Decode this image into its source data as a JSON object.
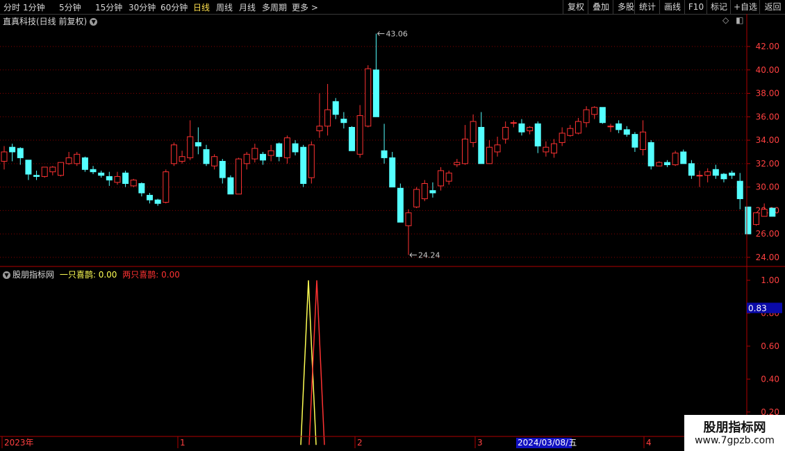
{
  "toolbar": {
    "left": [
      {
        "label": "分时",
        "x": 5
      },
      {
        "label": "1分钟",
        "x": 33
      },
      {
        "label": "5分钟",
        "x": 85
      },
      {
        "label": "15分钟",
        "x": 137
      },
      {
        "label": "30分钟",
        "x": 185
      },
      {
        "label": "60分钟",
        "x": 231
      },
      {
        "label": "日线",
        "x": 278,
        "active": true
      },
      {
        "label": "周线",
        "x": 311
      },
      {
        "label": "月线",
        "x": 344
      },
      {
        "label": "多周期",
        "x": 377
      },
      {
        "label": "更多 >",
        "x": 420
      }
    ],
    "right": [
      {
        "label": "复权",
        "x": 810,
        "w": 36
      },
      {
        "label": "叠加",
        "x": 846,
        "w": 36
      },
      {
        "label": "多股",
        "x": 882,
        "w": 36
      },
      {
        "label": "统计",
        "x": 913,
        "w": 36
      },
      {
        "label": "画线",
        "x": 949,
        "w": 36
      },
      {
        "label": "F10",
        "x": 985,
        "w": 32
      },
      {
        "label": "标记",
        "x": 1017,
        "w": 34
      },
      {
        "label": "+自选",
        "x": 1051,
        "w": 42
      },
      {
        "label": "返回",
        "x": 1093,
        "w": 37
      }
    ]
  },
  "main_title": "直真科技(日线 前复权)",
  "indicator": {
    "name": "股朋指标网",
    "s1_label": "一只喜鹊:",
    "s1_value": "0.00",
    "s2_label": "两只喜鹊:",
    "s2_value": "0.00"
  },
  "price_marker": "0.83",
  "dates": [
    {
      "label": "2023年",
      "x": 6
    },
    {
      "label": "1",
      "x": 259
    },
    {
      "label": "2",
      "x": 514
    },
    {
      "label": "3",
      "x": 687
    },
    {
      "label": "4",
      "x": 930
    }
  ],
  "cursor_date": "2024/03/08/五",
  "watermark": {
    "line1": "股朋指标网",
    "line2": "www.7gpzb.com"
  },
  "colors": {
    "up": "#ff3232",
    "down": "#54ffff",
    "s1": "#ffff54",
    "s2": "#ff3232",
    "grid": "#8b0000",
    "axis": "#b00000"
  },
  "chart_data": [
    {
      "type": "candlestick",
      "title": "直真科技(日线 前复权)",
      "ylim": [
        23.4,
        43.6
      ],
      "yticks": [
        24,
        26,
        28,
        30,
        32,
        34,
        36,
        38,
        40,
        42
      ],
      "high_label": "43.06",
      "low_label": "24.24",
      "candles": [
        [
          32.2,
          33.0,
          31.5,
          33.5
        ],
        [
          33.4,
          33.0,
          32.2,
          33.7
        ],
        [
          33.3,
          32.5,
          31.9,
          33.4
        ],
        [
          32.3,
          31.1,
          30.6,
          32.3
        ],
        [
          31.0,
          30.9,
          30.6,
          31.4
        ],
        [
          30.9,
          31.7,
          30.8,
          31.7
        ],
        [
          31.3,
          31.7,
          31.0,
          31.8
        ],
        [
          31.0,
          32.1,
          30.9,
          32.1
        ],
        [
          32.0,
          32.5,
          31.9,
          33.0
        ],
        [
          32.0,
          32.8,
          31.8,
          33.0
        ],
        [
          32.5,
          31.5,
          31.3,
          32.6
        ],
        [
          31.5,
          31.3,
          31.1,
          31.8
        ],
        [
          31.2,
          31.0,
          30.8,
          31.4
        ],
        [
          30.9,
          30.6,
          30.1,
          31.3
        ],
        [
          30.4,
          30.9,
          30.2,
          31.3
        ],
        [
          31.2,
          30.3,
          30.0,
          31.4
        ],
        [
          30.1,
          30.6,
          30.0,
          30.7
        ],
        [
          30.3,
          29.5,
          29.2,
          30.4
        ],
        [
          29.3,
          28.9,
          28.6,
          29.5
        ],
        [
          28.9,
          28.6,
          28.4,
          29.0
        ],
        [
          28.7,
          31.3,
          28.6,
          31.5
        ],
        [
          32.0,
          33.6,
          31.8,
          33.8
        ],
        [
          32.2,
          32.6,
          32.0,
          33.1
        ],
        [
          32.5,
          34.3,
          32.3,
          35.7
        ],
        [
          33.8,
          33.5,
          32.8,
          35.1
        ],
        [
          33.2,
          32.0,
          31.8,
          33.6
        ],
        [
          31.8,
          32.6,
          31.5,
          32.8
        ],
        [
          32.2,
          30.8,
          30.3,
          32.4
        ],
        [
          30.8,
          29.4,
          29.4,
          31.0
        ],
        [
          29.4,
          32.4,
          29.4,
          32.5
        ],
        [
          32.0,
          32.8,
          31.5,
          33.0
        ],
        [
          32.4,
          33.3,
          32.1,
          33.7
        ],
        [
          32.8,
          32.3,
          31.9,
          33.0
        ],
        [
          32.7,
          33.1,
          32.2,
          33.6
        ],
        [
          33.7,
          32.6,
          32.2,
          33.8
        ],
        [
          32.5,
          34.2,
          32.0,
          34.4
        ],
        [
          33.7,
          33.0,
          32.7,
          34.0
        ],
        [
          33.4,
          30.3,
          30.0,
          33.6
        ],
        [
          30.8,
          33.6,
          30.3,
          33.9
        ],
        [
          34.8,
          35.2,
          34.2,
          38.0
        ],
        [
          35.2,
          36.6,
          34.4,
          38.8
        ],
        [
          37.3,
          36.2,
          35.8,
          37.6
        ],
        [
          35.8,
          35.5,
          35.0,
          36.4
        ],
        [
          35.1,
          33.1,
          33.1,
          35.2
        ],
        [
          32.8,
          36.1,
          32.5,
          37.0
        ],
        [
          35.2,
          40.1,
          35.1,
          40.4
        ],
        [
          40.0,
          36.0,
          36.0,
          43.1
        ],
        [
          33.1,
          32.5,
          32.0,
          35.4
        ],
        [
          32.5,
          30.0,
          30.0,
          33.0
        ],
        [
          29.9,
          27.0,
          27.0,
          30.3
        ],
        [
          26.7,
          27.8,
          24.2,
          28.1
        ],
        [
          28.3,
          29.8,
          28.2,
          30.0
        ],
        [
          29.0,
          30.3,
          28.8,
          30.6
        ],
        [
          29.7,
          29.5,
          29.1,
          30.4
        ],
        [
          30.1,
          31.4,
          29.7,
          31.7
        ],
        [
          30.5,
          31.2,
          30.2,
          31.4
        ],
        [
          31.9,
          32.1,
          31.7,
          32.4
        ],
        [
          32.0,
          34.1,
          31.9,
          35.3
        ],
        [
          33.8,
          35.6,
          33.4,
          36.2
        ],
        [
          35.1,
          32.0,
          32.0,
          36.4
        ],
        [
          32.0,
          33.4,
          32.0,
          34.0
        ],
        [
          33.0,
          33.6,
          32.6,
          34.3
        ],
        [
          34.1,
          35.1,
          33.7,
          35.6
        ],
        [
          35.5,
          35.5,
          35.1,
          35.7
        ],
        [
          35.4,
          34.7,
          34.4,
          35.8
        ],
        [
          34.8,
          35.1,
          34.5,
          35.2
        ],
        [
          35.4,
          33.5,
          32.9,
          35.6
        ],
        [
          33.0,
          33.4,
          32.6,
          33.9
        ],
        [
          32.9,
          33.7,
          32.5,
          34.1
        ],
        [
          33.8,
          34.6,
          33.5,
          35.1
        ],
        [
          34.4,
          35.0,
          34.3,
          35.3
        ],
        [
          34.6,
          35.6,
          34.5,
          35.9
        ],
        [
          35.5,
          36.6,
          35.1,
          36.9
        ],
        [
          36.2,
          36.8,
          35.8,
          36.9
        ],
        [
          36.8,
          35.5,
          35.4,
          36.8
        ],
        [
          35.2,
          35.2,
          34.7,
          35.4
        ],
        [
          35.4,
          34.9,
          34.6,
          35.7
        ],
        [
          34.9,
          34.5,
          34.3,
          35.2
        ],
        [
          34.5,
          33.4,
          33.0,
          34.7
        ],
        [
          33.2,
          34.7,
          32.7,
          35.7
        ],
        [
          33.8,
          31.8,
          31.5,
          34.0
        ],
        [
          31.8,
          32.1,
          31.8,
          32.2
        ],
        [
          32.1,
          31.9,
          31.7,
          32.3
        ],
        [
          31.9,
          32.9,
          31.8,
          33.1
        ],
        [
          33.0,
          32.0,
          32.0,
          33.2
        ],
        [
          32.0,
          31.0,
          30.7,
          32.3
        ],
        [
          31.0,
          31.0,
          30.0,
          31.4
        ],
        [
          31.0,
          31.3,
          30.4,
          31.6
        ],
        [
          31.5,
          31.0,
          30.7,
          31.9
        ],
        [
          31.1,
          30.7,
          30.4,
          31.2
        ],
        [
          31.2,
          31.0,
          30.7,
          31.4
        ],
        [
          30.5,
          29.0,
          28.1,
          31.2
        ],
        [
          28.3,
          26.0,
          26.0,
          28.3
        ],
        [
          26.8,
          27.8,
          26.7,
          27.8
        ],
        [
          27.5,
          28.1,
          27.5,
          28.6
        ],
        [
          28.2,
          27.5,
          27.5,
          28.2
        ]
      ]
    },
    {
      "type": "line",
      "ylim": [
        0.06,
        1.08
      ],
      "yticks": [
        0.2,
        0.4,
        0.6,
        0.8,
        1.0
      ],
      "series": [
        {
          "name": "一只喜鹊",
          "x": [
            433,
            444,
            455
          ],
          "values": [
            0,
            1,
            0
          ]
        },
        {
          "name": "两只喜鹊",
          "x": [
            445,
            456,
            467
          ],
          "values": [
            0,
            1,
            0
          ]
        }
      ]
    }
  ]
}
